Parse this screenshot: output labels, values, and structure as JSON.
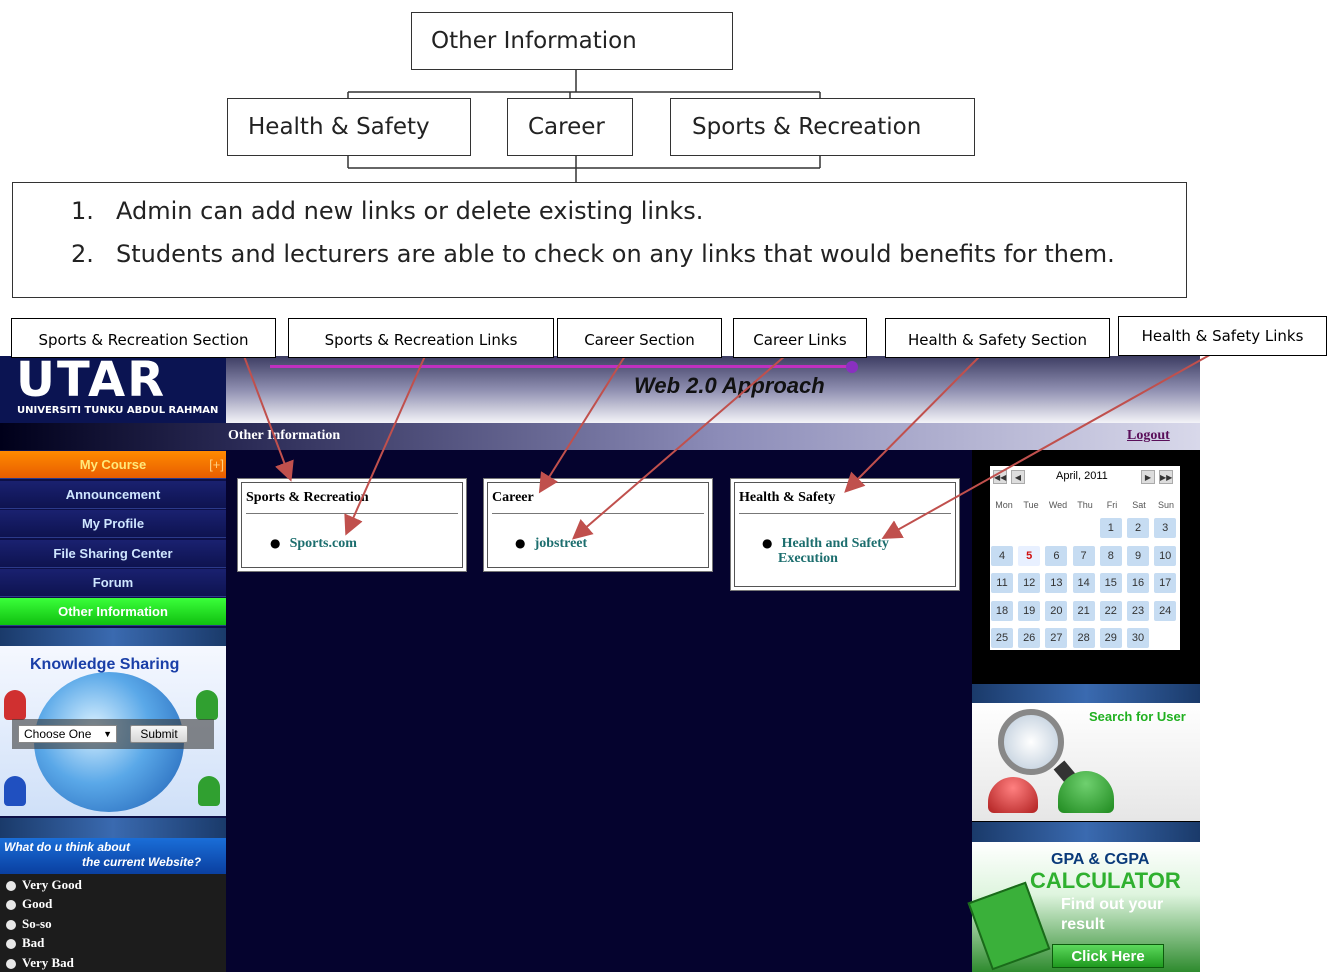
{
  "diagram": {
    "root": "Other Information",
    "children": [
      "Health & Safety",
      "Career",
      "Sports & Recreation"
    ],
    "notes": [
      {
        "num": "1.",
        "text": "Admin can add new links or delete existing links."
      },
      {
        "num": "2.",
        "text": "Students and lecturers are able to check on any links that would benefits for them."
      }
    ]
  },
  "annotations": {
    "sports_section": "Sports & Recreation Section",
    "sports_links": "Sports & Recreation Links",
    "career_section": "Career Section",
    "career_links": "Career Links",
    "health_section": "Health & Safety Section",
    "health_links": "Health & Safety Links"
  },
  "header": {
    "logo": "UTAR",
    "logo_sub": "UNIVERSITI TUNKU ABDUL RAHMAN",
    "tagline": "Web 2.0 Approach",
    "page_title": "Other Information",
    "logout": "Logout"
  },
  "menu": {
    "course": "My Course",
    "course_expand": "[+]",
    "items": [
      "Announcement",
      "My Profile",
      "File Sharing Center",
      "Forum",
      "Other Information"
    ]
  },
  "knowledge": {
    "title": "Knowledge Sharing",
    "select_value": "Choose One",
    "submit": "Submit"
  },
  "poll": {
    "q1": "What do u think about",
    "q2": "the current Website?",
    "options": [
      "Very Good",
      "Good",
      "So-so",
      "Bad",
      "Very Bad"
    ]
  },
  "sections": [
    {
      "title": "Sports & Recreation",
      "links": [
        "Sports.com"
      ]
    },
    {
      "title": "Career",
      "links": [
        "jobstreet"
      ]
    },
    {
      "title": "Health & Safety",
      "links": [
        "Health and Safety",
        "Execution"
      ]
    }
  ],
  "calendar": {
    "month": "April, 2011",
    "days": [
      "Mon",
      "Tue",
      "Wed",
      "Thu",
      "Fri",
      "Sat",
      "Sun"
    ],
    "today": "5",
    "prev2": "◀◀",
    "prev": "◀",
    "next": "▶",
    "next2": "▶▶"
  },
  "search_user": "Search for User",
  "gpa": {
    "line1": "GPA & CGPA",
    "line2": "CALCULATOR",
    "line3": "Find out your",
    "line4": "result",
    "button": "Click Here"
  },
  "colors": {
    "site_bg": "#05032e",
    "menu_course": "#ff7a00",
    "menu_active": "#20e020",
    "arrow": "#c0504d",
    "link": "#1c6e6e"
  }
}
